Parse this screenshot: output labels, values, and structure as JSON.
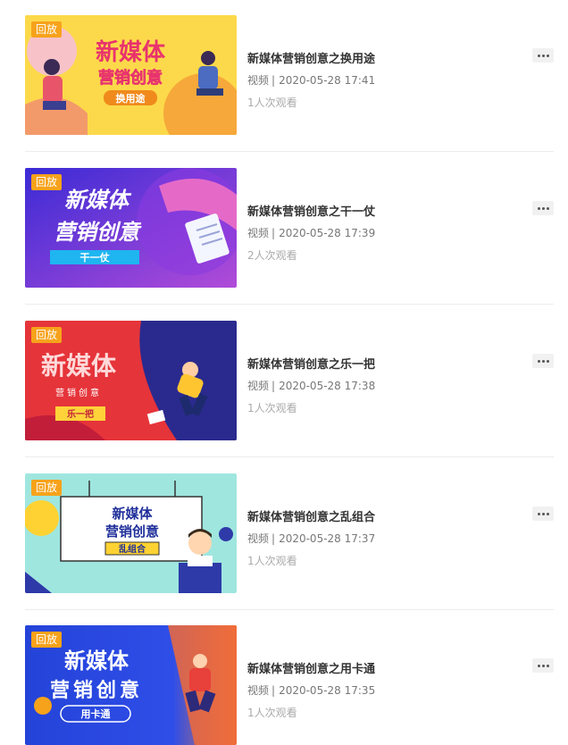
{
  "videos": [
    {
      "badge": "回放",
      "title": "新媒体营销创意之换用途",
      "type": "视频",
      "divider": "|",
      "datetime": "2020-05-28 17:41",
      "views": "1人次观看",
      "thumb": {
        "line1": "新媒体",
        "line2": "营销创意",
        "tag": "换用途"
      }
    },
    {
      "badge": "回放",
      "title": "新媒体营销创意之干一仗",
      "type": "视频",
      "divider": "|",
      "datetime": "2020-05-28 17:39",
      "views": "2人次观看",
      "thumb": {
        "line1": "新媒体",
        "line2": "营销创意",
        "tag": "干一仗"
      }
    },
    {
      "badge": "回放",
      "title": "新媒体营销创意之乐一把",
      "type": "视频",
      "divider": "|",
      "datetime": "2020-05-28 17:38",
      "views": "1人次观看",
      "thumb": {
        "line1": "新媒体",
        "line2": "营销创意",
        "tag": "乐一把"
      }
    },
    {
      "badge": "回放",
      "title": "新媒体营销创意之乱组合",
      "type": "视频",
      "divider": "|",
      "datetime": "2020-05-28 17:37",
      "views": "1人次观看",
      "thumb": {
        "line1": "新媒体",
        "line2": "营销创意",
        "tag": "乱组合"
      }
    },
    {
      "badge": "回放",
      "title": "新媒体营销创意之用卡通",
      "type": "视频",
      "divider": "|",
      "datetime": "2020-05-28 17:35",
      "views": "1人次观看",
      "thumb": {
        "line1": "新媒体",
        "line2": "营销创意",
        "tag": "用卡通"
      }
    }
  ],
  "colors": {
    "badge": "#f7a21b",
    "title": "#333333",
    "meta": "#777777",
    "views": "#aaaaaa",
    "separator": "#ececec"
  },
  "icons": {
    "more": "more-dots-icon"
  }
}
